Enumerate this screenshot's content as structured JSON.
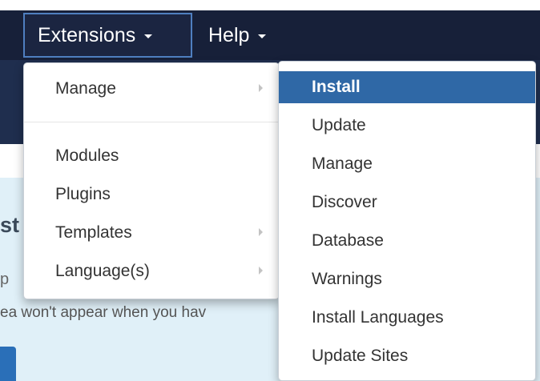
{
  "navbar": {
    "items": [
      {
        "label": "Extensions",
        "active": true
      },
      {
        "label": "Help",
        "active": false
      }
    ]
  },
  "background": {
    "heading_fragment": "st",
    "paragraph_fragment": "p",
    "hint_fragment": "ea won't appear when you hav"
  },
  "extensions_menu": {
    "items": [
      {
        "label": "Manage",
        "has_submenu": true
      },
      {
        "label": "Modules",
        "has_submenu": false
      },
      {
        "label": "Plugins",
        "has_submenu": false
      },
      {
        "label": "Templates",
        "has_submenu": true
      },
      {
        "label": "Language(s)",
        "has_submenu": true
      }
    ]
  },
  "manage_submenu": {
    "items": [
      {
        "label": "Install",
        "active": true
      },
      {
        "label": "Update",
        "active": false
      },
      {
        "label": "Manage",
        "active": false
      },
      {
        "label": "Discover",
        "active": false
      },
      {
        "label": "Database",
        "active": false
      },
      {
        "label": "Warnings",
        "active": false
      },
      {
        "label": "Install Languages",
        "active": false
      },
      {
        "label": "Update Sites",
        "active": false
      }
    ]
  },
  "colors": {
    "navbar": "#172039",
    "subbar": "#1f2e4e",
    "active_item": "#2f68a6",
    "info_panel": "#e0f0f8"
  }
}
